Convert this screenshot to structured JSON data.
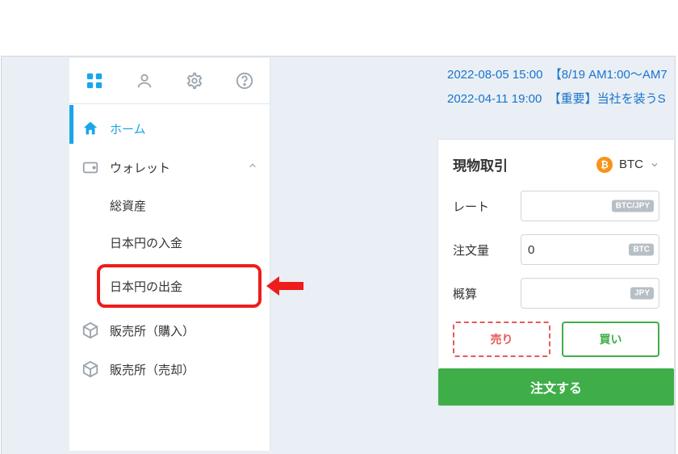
{
  "annotation": {
    "highlight_target": "sidebar-wallet-withdraw-jpy"
  },
  "announcements": [
    {
      "date": "2022-08-05 15:00",
      "title": "【8/19 AM1:00～AM7"
    },
    {
      "date": "2022-04-11 19:00",
      "title": "【重要】当社を装うS"
    }
  ],
  "sidebar": {
    "icon_tabs": [
      "apps",
      "user",
      "settings",
      "help"
    ],
    "active_icon_index": 0,
    "home": "ホーム",
    "wallet": {
      "label": "ウォレット",
      "expanded": true,
      "items": {
        "total_assets": "総資産",
        "deposit_jpy": "日本円の入金",
        "withdraw_jpy": "日本円の出金"
      }
    },
    "sales_buy": "販売所（購入）",
    "sales_sell": "販売所（売却）"
  },
  "trade": {
    "title": "現物取引",
    "pair_symbol": "BTC",
    "rate_label": "レート",
    "rate_suffix": "BTC/JPY",
    "amount_label": "注文量",
    "amount_value": "0",
    "amount_suffix": "BTC",
    "approx_label": "概算",
    "approx_suffix": "JPY",
    "sell": "売り",
    "buy": "買い",
    "order": "注文する"
  }
}
